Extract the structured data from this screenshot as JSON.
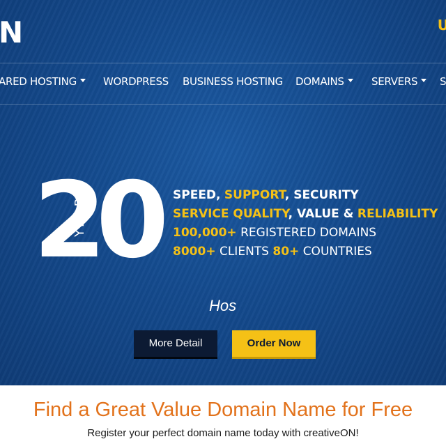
{
  "brand": {
    "logo_partial": "N",
    "top_right_partial": "U"
  },
  "nav": {
    "items": [
      {
        "label": "ARED HOSTING",
        "dropdown": true
      },
      {
        "label": "WORDPRESS",
        "dropdown": false
      },
      {
        "label": "BUSINESS HOSTING",
        "dropdown": false
      },
      {
        "label": "DOMAINS",
        "dropdown": true
      },
      {
        "label": "SERVERS",
        "dropdown": true
      },
      {
        "label": "S",
        "dropdown": false
      }
    ]
  },
  "hero": {
    "big_number_first": "2",
    "big_number_second": "0",
    "years_label": "YEARS",
    "features": {
      "line1": {
        "a": "SPEED,",
        "b": "SUPPORT",
        "c": ", SECURITY"
      },
      "line2": {
        "a": "SERVICE QUALITY",
        "b": ", VALUE &",
        "c": "RELIABILITY"
      },
      "line3": {
        "a": "100,000+",
        "b": "REGISTERED DOMAINS"
      },
      "line4": {
        "a": "8000+",
        "b": "CLIENTS",
        "c": "80+",
        "d": "COUNTRIES"
      }
    },
    "typing_text": "Hos",
    "more_detail_label": "More Detail",
    "order_now_label": "Order Now"
  },
  "domain_section": {
    "headline": "Find a Great Value Domain Name for Free",
    "subheadline": "Register your perfect domain name today with creativeON!"
  },
  "colors": {
    "accent_yellow": "#f5c116",
    "hero_blue": "#144a8d",
    "headline_orange": "#e2721b",
    "dark_button": "#0c1a33"
  }
}
